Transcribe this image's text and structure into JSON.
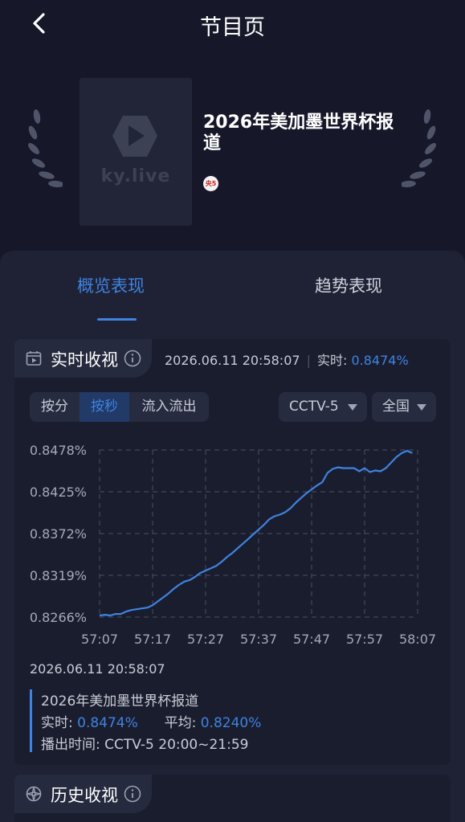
{
  "header": {
    "title": "节目页",
    "back_icon": "back-arrow-icon"
  },
  "program": {
    "poster_logo_text": "ky.live",
    "title": "2026年美加墨世界杯报道",
    "channel_badge": "央5"
  },
  "tabs": [
    {
      "label": "概览表现",
      "active": true
    },
    {
      "label": "趋势表现",
      "active": false
    }
  ],
  "live": {
    "section_title": "实时收视",
    "timestamp": "2026.06.11 20:58:07",
    "realtime_label": "实时:",
    "realtime_value": "0.8474%",
    "segments": [
      "按分",
      "按秒",
      "流入流出"
    ],
    "active_segment": "按秒",
    "channel": "CCTV-5",
    "region": "全国"
  },
  "chart_data": {
    "type": "line",
    "x_ticks": [
      "57:07",
      "57:17",
      "57:27",
      "57:37",
      "57:47",
      "57:57",
      "58:07"
    ],
    "y_ticks": [
      "0.8478%",
      "0.8425%",
      "0.8372%",
      "0.8319%",
      "0.8266%"
    ],
    "ylim": [
      0.8266,
      0.8478
    ],
    "xlim_seconds_from_first_tick": [
      0,
      60
    ],
    "grid": true,
    "line_color": "#3f83e0",
    "series": [
      {
        "x": [
          0,
          1,
          2,
          3,
          4,
          5,
          6,
          7,
          8,
          9,
          10,
          11,
          12,
          13,
          14,
          15,
          16,
          17,
          18,
          19,
          20,
          21,
          22,
          23,
          24,
          25,
          26,
          27,
          28,
          29,
          30,
          31,
          32,
          33,
          34,
          35,
          36,
          37,
          38,
          39,
          40,
          41,
          42,
          43,
          44,
          45,
          46,
          47,
          48,
          49,
          50,
          51,
          52,
          53,
          54,
          55,
          56,
          57,
          58,
          59
        ],
        "values": [
          0.8268,
          0.8269,
          0.8268,
          0.827,
          0.827,
          0.8273,
          0.8275,
          0.8276,
          0.8277,
          0.8278,
          0.8281,
          0.8286,
          0.8291,
          0.8296,
          0.8302,
          0.8307,
          0.8311,
          0.8313,
          0.8317,
          0.8322,
          0.8325,
          0.8328,
          0.8331,
          0.8336,
          0.8342,
          0.8347,
          0.8353,
          0.8359,
          0.8365,
          0.8371,
          0.8377,
          0.8383,
          0.839,
          0.8394,
          0.8396,
          0.8399,
          0.8404,
          0.8411,
          0.8417,
          0.8423,
          0.8428,
          0.8433,
          0.8437,
          0.8449,
          0.8454,
          0.8456,
          0.8455,
          0.8455,
          0.8455,
          0.8451,
          0.8455,
          0.845,
          0.8452,
          0.8451,
          0.8455,
          0.8462,
          0.8469,
          0.8474,
          0.8477,
          0.8474
        ]
      }
    ]
  },
  "detail": {
    "timestamp": "2026.06.11 20:58:07",
    "program_title": "2026年美加墨世界杯报道",
    "realtime_label": "实时:",
    "realtime_value": "0.8474%",
    "avg_label": "平均:",
    "avg_value": "0.8240%",
    "airtime_label": "播出时间:",
    "airtime_value": "CCTV-5 20:00~21:59"
  },
  "history": {
    "section_title": "历史收视"
  },
  "colors": {
    "accent": "#3f83e0",
    "background": "#16182a",
    "panel": "#1f2235"
  }
}
